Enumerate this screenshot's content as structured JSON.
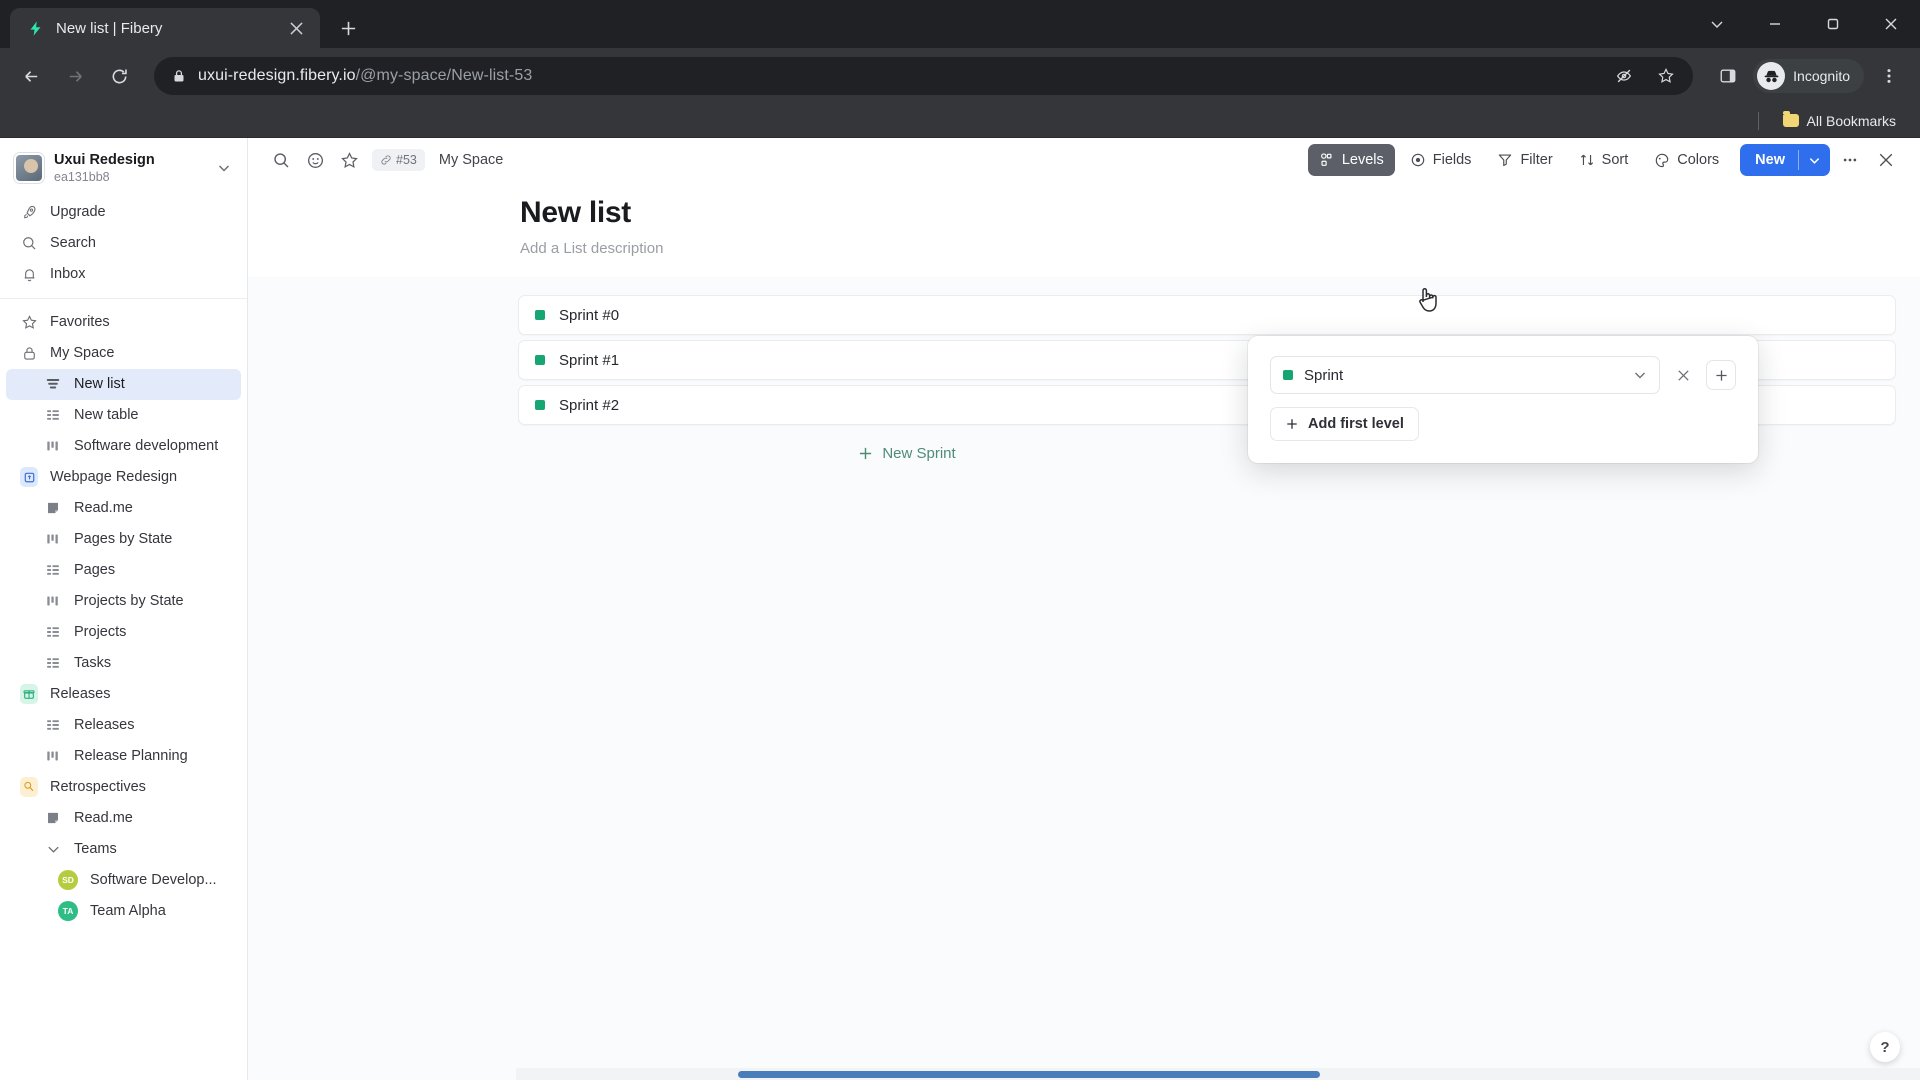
{
  "browser": {
    "tab": {
      "title": "New list | Fibery",
      "favicon": "fibery-icon",
      "close": "close-icon"
    },
    "new_tab_label": "+",
    "window_controls": {
      "list": "chevron-down-icon",
      "minimize": "minimize-icon",
      "maximize": "restore-icon",
      "close": "close-icon"
    },
    "nav": {
      "back": "back-arrow-icon",
      "forward": "forward-arrow-icon",
      "reload": "reload-icon"
    },
    "omnibox": {
      "lock": "lock-icon",
      "url_domain": "uxui-redesign.fibery.io",
      "url_path": "/@my-space/New-list-53",
      "icons": [
        "eye-slash-icon",
        "star-icon"
      ]
    },
    "side_panel": "side-panel-icon",
    "profile": {
      "label": "Incognito",
      "avatar": "incognito-icon"
    },
    "menu": "kebab-menu-icon",
    "bookmarks": {
      "label": "All Bookmarks",
      "icon": "folder-icon"
    }
  },
  "sidebar": {
    "workspace": {
      "name": "Uxui Redesign",
      "id": "ea131bb8",
      "avatar": "user-avatar",
      "chevron": "chevron-down-icon"
    },
    "top_items": [
      {
        "label": "Upgrade",
        "icon": "rocket-icon"
      },
      {
        "label": "Search",
        "icon": "search-icon"
      },
      {
        "label": "Inbox",
        "icon": "bell-icon"
      }
    ],
    "items": [
      {
        "label": "Favorites",
        "icon": "star-icon",
        "level": 0,
        "active": false
      },
      {
        "label": "My Space",
        "icon": "lock-icon",
        "level": 0,
        "active": false
      },
      {
        "label": "New list",
        "icon": "list-view-icon",
        "level": 1,
        "active": true
      },
      {
        "label": "New table",
        "icon": "table-view-icon",
        "level": 1,
        "active": false
      },
      {
        "label": "Software development",
        "icon": "board-view-icon",
        "level": 1,
        "active": false
      },
      {
        "label": "Webpage Redesign",
        "icon": "space-blue-icon",
        "level": 0,
        "active": false
      },
      {
        "label": "Read.me",
        "icon": "document-icon",
        "level": 1,
        "active": false
      },
      {
        "label": "Pages by State",
        "icon": "board-view-icon",
        "level": 1,
        "active": false
      },
      {
        "label": "Pages",
        "icon": "table-view-icon",
        "level": 1,
        "active": false
      },
      {
        "label": "Projects by State",
        "icon": "board-view-icon",
        "level": 1,
        "active": false
      },
      {
        "label": "Projects",
        "icon": "table-view-icon",
        "level": 1,
        "active": false
      },
      {
        "label": "Tasks",
        "icon": "table-view-icon",
        "level": 1,
        "active": false
      },
      {
        "label": "Releases",
        "icon": "space-green-gift-icon",
        "level": 0,
        "active": false
      },
      {
        "label": "Releases",
        "icon": "table-view-icon",
        "level": 1,
        "active": false
      },
      {
        "label": "Release Planning",
        "icon": "board-view-icon",
        "level": 1,
        "active": false
      },
      {
        "label": "Retrospectives",
        "icon": "space-orange-icon",
        "level": 0,
        "active": false
      },
      {
        "label": "Read.me",
        "icon": "document-icon",
        "level": 1,
        "active": false
      },
      {
        "label": "Teams",
        "icon": "chevron-down-icon",
        "level": 1,
        "active": false
      },
      {
        "label": "Software Develop...",
        "icon": "avatar-sd",
        "level": 2,
        "active": false,
        "initials": "SD",
        "color": "#b5cc3e"
      },
      {
        "label": "Team Alpha",
        "icon": "avatar-ta",
        "level": 2,
        "active": false,
        "initials": "TA",
        "color": "#2ebd85"
      }
    ]
  },
  "doc": {
    "toolbar_left": {
      "search": "search-icon",
      "emoji": "smiley-icon",
      "favorite": "star-icon",
      "id_chip": "#53",
      "id_chip_icon": "link-icon",
      "breadcrumb": "My Space"
    },
    "toolbar_right": [
      {
        "label": "Levels",
        "icon": "levels-icon",
        "active": true
      },
      {
        "label": "Fields",
        "icon": "fields-icon",
        "active": false
      },
      {
        "label": "Filter",
        "icon": "filter-icon",
        "active": false
      },
      {
        "label": "Sort",
        "icon": "sort-icon",
        "active": false
      },
      {
        "label": "Colors",
        "icon": "colors-icon",
        "active": false
      }
    ],
    "new_button": {
      "label": "New",
      "chevron": "chevron-down-icon"
    },
    "more": "ellipsis-icon",
    "close": "close-icon",
    "title": "New list",
    "description_placeholder": "Add a List description"
  },
  "list": {
    "rows": [
      {
        "label": "Sprint #0",
        "color": "#17a673"
      },
      {
        "label": "Sprint #1",
        "color": "#17a673"
      },
      {
        "label": "Sprint #2",
        "color": "#17a673"
      }
    ],
    "new_entity": {
      "label": "New Sprint",
      "icon": "plus-icon"
    }
  },
  "levels_popover": {
    "level_value": "Sprint",
    "level_color": "#17a673",
    "chevron": "chevron-down-icon",
    "remove": "close-icon",
    "add": "plus-icon",
    "add_first_level": "Add first level",
    "add_first_level_icon": "plus-icon"
  },
  "help": {
    "label": "?"
  },
  "colors": {
    "accent_blue": "#2f6fed",
    "green": "#17a673",
    "active_nav": "#e3ebfa",
    "chrome_dark": "#35363a",
    "scrollbar": "#4a7ebb"
  }
}
